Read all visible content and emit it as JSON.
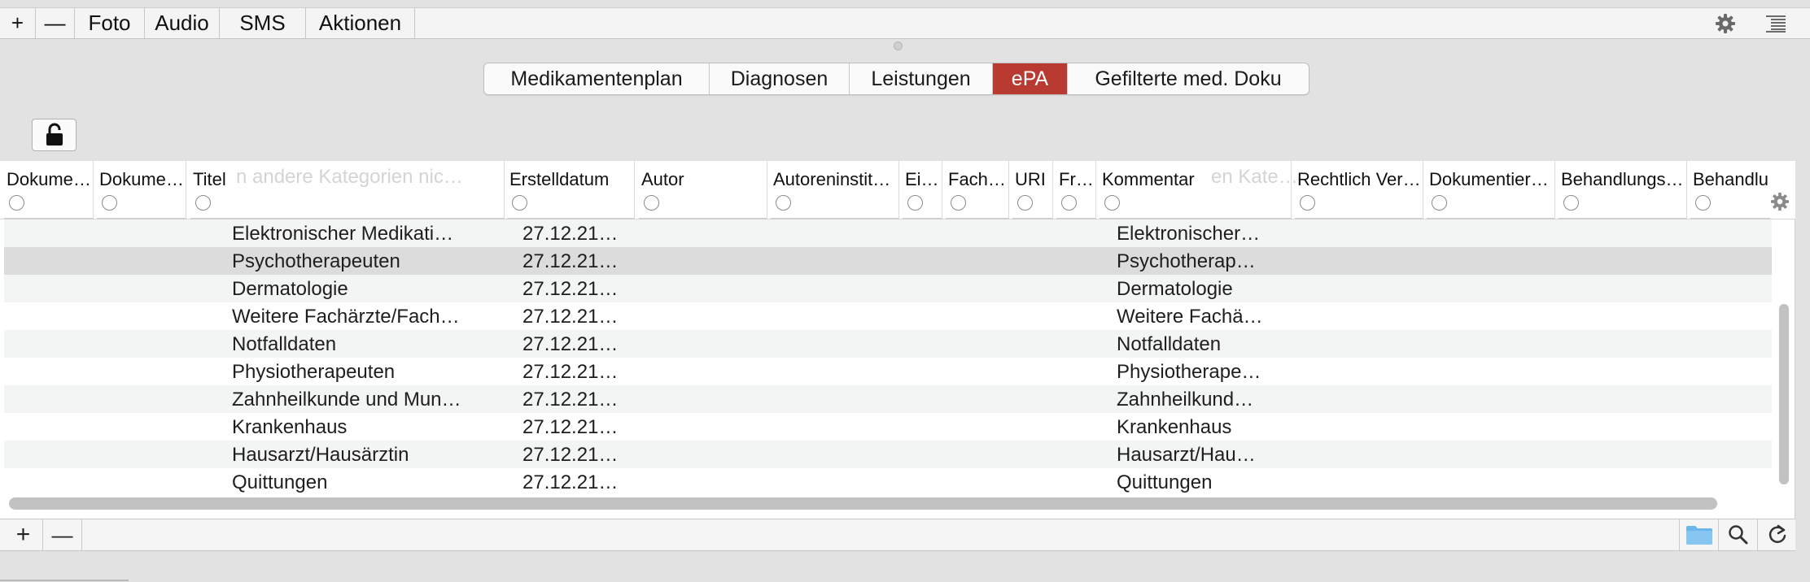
{
  "toolbar": {
    "add_label": "+",
    "remove_label": "—",
    "foto_label": "Foto",
    "audio_label": "Audio",
    "sms_label": "SMS",
    "aktionen_label": "Aktionen",
    "icons": [
      "gear-icon",
      "list-icon"
    ]
  },
  "tabs": [
    {
      "label": "Medikamentenplan",
      "active": false
    },
    {
      "label": "Diagnosen",
      "active": false
    },
    {
      "label": "Leistungen",
      "active": false
    },
    {
      "label": "ePA",
      "active": true
    },
    {
      "label": "Gefilterte med. Doku",
      "active": false
    }
  ],
  "colors": {
    "active_tab": "#b83a30",
    "selected_row": "#dcdcdc",
    "folder": "#6bb6ea"
  },
  "lock": {
    "icon": "lock-open-icon"
  },
  "table": {
    "columns": [
      "Dokume…",
      "Dokume…",
      "Titel",
      "Erstelldatum",
      "Autor",
      "Autoreninstit…",
      "Ei…",
      "Fach…",
      "URI",
      "Fr…",
      "Kommentar",
      "Rechtlich Ver…",
      "Dokumentier…",
      "Behandlungs…",
      "Behandlu"
    ],
    "ghost_text_1": "n andere Kategorien nic…",
    "ghost_text_2": "en Kate…",
    "rows": [
      {
        "titel": "Elektronischer Medikati…",
        "datum": "27.12.21…",
        "kommentar": "Elektronischer…"
      },
      {
        "titel": "Psychotherapeuten",
        "datum": "27.12.21…",
        "kommentar": "Psychotherap…",
        "selected": true
      },
      {
        "titel": "Dermatologie",
        "datum": "27.12.21…",
        "kommentar": "Dermatologie"
      },
      {
        "titel": "Weitere Fachärzte/Fach…",
        "datum": "27.12.21…",
        "kommentar": "Weitere Fachä…"
      },
      {
        "titel": "Notfalldaten",
        "datum": "27.12.21…",
        "kommentar": "Notfalldaten"
      },
      {
        "titel": "Physiotherapeuten",
        "datum": "27.12.21…",
        "kommentar": "Physiotherape…"
      },
      {
        "titel": "Zahnheilkunde und Mun…",
        "datum": "27.12.21…",
        "kommentar": "Zahnheilkund…"
      },
      {
        "titel": "Krankenhaus",
        "datum": "27.12.21…",
        "kommentar": "Krankenhaus"
      },
      {
        "titel": "Hausarzt/Hausärztin",
        "datum": "27.12.21…",
        "kommentar": "Hausarzt/Hau…"
      },
      {
        "titel": "Quittungen",
        "datum": "27.12.21…",
        "kommentar": "Quittungen"
      }
    ]
  },
  "bottombar": {
    "add_label": "+",
    "remove_label": "—",
    "icons": [
      "folder-icon",
      "search-icon",
      "refresh-icon"
    ]
  }
}
